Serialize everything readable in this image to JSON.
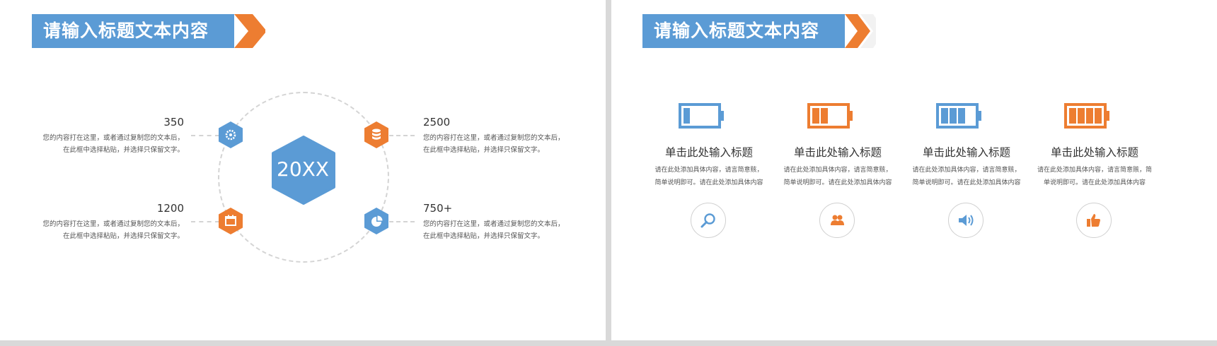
{
  "colors": {
    "blue": "#5b9bd5",
    "orange": "#ed7d31",
    "ring": "#d4d4d4"
  },
  "left_slide": {
    "title": "请输入标题文本内容",
    "center_label": "20XX",
    "items": [
      {
        "value": "350",
        "icon": "gear-icon",
        "color": "blue",
        "lines": [
          "您的内容打在这里，或者通过复制您的文本后，",
          "在此框中选择粘贴，并选择只保留文字。"
        ]
      },
      {
        "value": "2500",
        "icon": "database-icon",
        "color": "orange",
        "lines": [
          "您的内容打在这里，或者通过复制您的文本后，",
          "在此框中选择粘贴，并选择只保留文字。"
        ]
      },
      {
        "value": "1200",
        "icon": "calendar-icon",
        "color": "orange",
        "lines": [
          "您的内容打在这里，或者通过复制您的文本后，",
          "在此框中选择粘贴，并选择只保留文字。"
        ]
      },
      {
        "value": "750+",
        "icon": "pie-chart-icon",
        "color": "blue",
        "lines": [
          "您的内容打在这里，或者通过复制您的文本后，",
          "在此框中选择粘贴，并选择只保留文字。"
        ]
      }
    ]
  },
  "right_slide": {
    "title": "请输入标题文本内容",
    "columns": [
      {
        "title": "单击此处输入标题",
        "lines": [
          "请在此处添加具体内容，请言简意赅，",
          "简单说明即可。请在此处添加具体内容"
        ],
        "battery_color": "blue",
        "battery_bars": 1,
        "icon": "search-icon"
      },
      {
        "title": "单击此处输入标题",
        "lines": [
          "请在此处添加具体内容，请言简意赅，",
          "简单说明即可。请在此处添加具体内容"
        ],
        "battery_color": "orange",
        "battery_bars": 2,
        "icon": "users-icon"
      },
      {
        "title": "单击此处输入标题",
        "lines": [
          "请在此处添加具体内容，请言简意赅，",
          "简单说明即可。请在此处添加具体内容"
        ],
        "battery_color": "blue",
        "battery_bars": 3,
        "icon": "speaker-icon"
      },
      {
        "title": "单击此处输入标题",
        "lines": [
          "请在此处添加具体内容，请言简意赅，简",
          "单说明即可。请在此处添加具体内容"
        ],
        "battery_color": "orange",
        "battery_bars": 4,
        "icon": "thumbs-up-icon"
      }
    ]
  }
}
